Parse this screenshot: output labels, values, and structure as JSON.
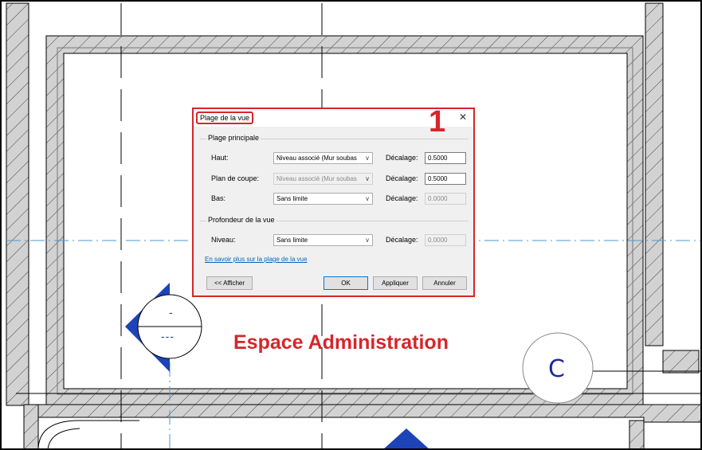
{
  "dialog": {
    "title": "Plage de la vue",
    "close_glyph": "✕",
    "step_marker": "1",
    "primary_group": {
      "legend": "Plage principale",
      "rows": [
        {
          "label": "Haut:",
          "level": "Niveau associé (Mur soubas",
          "offset_label": "Décalage:",
          "offset": "0.5000",
          "enabled": true
        },
        {
          "label": "Plan de coupe:",
          "level": "Niveau associé (Mur soubas",
          "offset_label": "Décalage:",
          "offset": "0.5000",
          "enabled": false
        },
        {
          "label": "Bas:",
          "level": "Sans limite",
          "offset_label": "Décalage:",
          "offset": "0.0000",
          "enabled": true
        }
      ]
    },
    "depth_group": {
      "legend": "Profondeur de la vue",
      "rows": [
        {
          "label": "Niveau:",
          "level": "Sans limite",
          "offset_label": "Décalage:",
          "offset": "0.0000",
          "enabled": true
        }
      ]
    },
    "help_link": "En savoir plus sur la plage de la vue",
    "buttons": {
      "show": "<< Afficher",
      "ok": "OK",
      "apply": "Appliquer",
      "cancel": "Annuler"
    }
  },
  "drawing": {
    "room_name": "Espace Administration",
    "grid_bubble_label": "C",
    "elevation_tag_top": "-",
    "elevation_tag_bottom": "---",
    "colors": {
      "annotation_red": "#d6262a",
      "symbol_blue": "#1f3f9e",
      "wall_gray": "#c8c8c8",
      "grid_dashdot": "#4a9ad8"
    }
  }
}
